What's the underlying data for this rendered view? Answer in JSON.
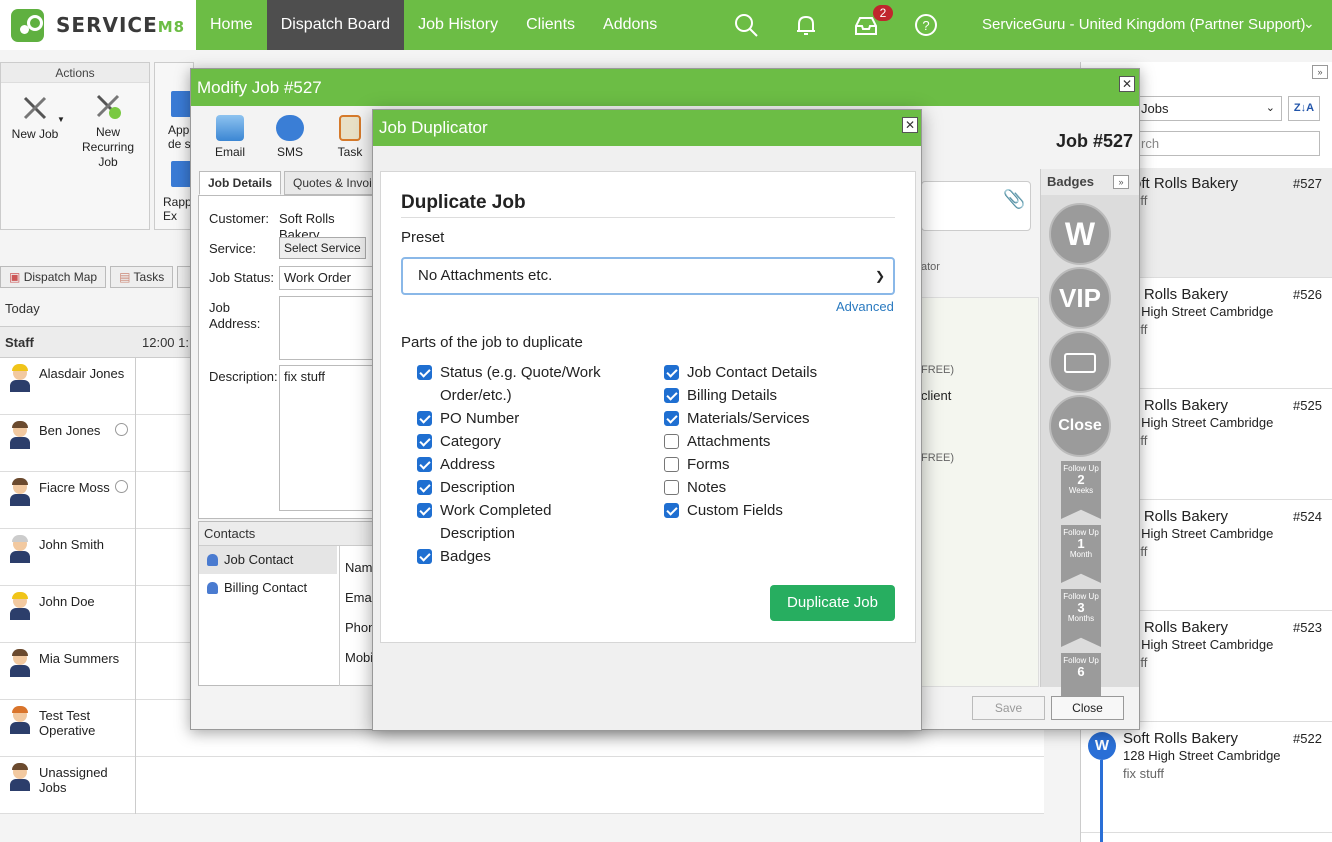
{
  "topbar": {
    "brand_main": "SERVICE",
    "brand_suffix": "M8",
    "nav": [
      "Home",
      "Dispatch Board",
      "Job History",
      "Clients",
      "Addons"
    ],
    "notification_count": "2",
    "account": "ServiceGuru - United Kingdom (Partner Support)"
  },
  "actions": {
    "title": "Actions",
    "new_job": "New Job",
    "new_recurring": "New Recurring Job",
    "partial_1": "App de s",
    "partial_2": "Rapp Ex"
  },
  "board": {
    "tabs": [
      "Dispatch Map",
      "Tasks"
    ],
    "today": "Today",
    "staff_header": "Staff",
    "time_header": "12:00  1:",
    "staff": [
      {
        "name": "Alasdair Jones",
        "hat": "#f0c419",
        "clock": false
      },
      {
        "name": "Ben Jones",
        "hat": "#6b4a2e",
        "clock": true
      },
      {
        "name": "Fiacre Moss",
        "hat": "#6b4a2e",
        "clock": true
      },
      {
        "name": "John Smith",
        "hat": "#cccccc",
        "clock": false
      },
      {
        "name": "John Doe",
        "hat": "#f0c419",
        "clock": false
      },
      {
        "name": "Mia Summers",
        "hat": "#6b4a2e",
        "clock": false
      },
      {
        "name": "Test Test Operative",
        "hat": "#d9742b",
        "clock": false
      },
      {
        "name": "Unassigned Jobs",
        "hat": "#6b4a2e",
        "clock": false
      }
    ]
  },
  "job_list": {
    "filter": "Jobs",
    "sort": "Z↓A",
    "search_placeholder": "rch",
    "jobs": [
      {
        "client": "Soft Rolls Bakery",
        "num": "#527",
        "addr": "",
        "desc": "stuff"
      },
      {
        "client": "oft Rolls Bakery",
        "num": "#526",
        "addr": "28 High Street Cambridge",
        "desc": "stuff"
      },
      {
        "client": "oft Rolls Bakery",
        "num": "#525",
        "addr": "28 High Street Cambridge",
        "desc": "stuff"
      },
      {
        "client": "oft Rolls Bakery",
        "num": "#524",
        "addr": "28 High Street Cambridge",
        "desc": "stuff"
      },
      {
        "client": "oft Rolls Bakery",
        "num": "#523",
        "addr": "28 High Street Cambridge",
        "desc": "stuff"
      },
      {
        "client": "Soft Rolls Bakery",
        "num": "#522",
        "addr": "128 High Street Cambridge",
        "desc": "fix stuff"
      }
    ]
  },
  "modify": {
    "title": "Modify Job #527",
    "tools": [
      "Email",
      "SMS",
      "Task"
    ],
    "job_header": "Job #527",
    "tabs": [
      "Job Details",
      "Quotes & Invoic"
    ],
    "customer_label": "Customer:",
    "customer_value": "Soft Rolls Bakery",
    "service_label": "Service:",
    "service_button": "Select Service",
    "status_label": "Job Status:",
    "status_value": "Work Order",
    "address_label": "Job Address:",
    "description_label": "Description:",
    "description_value": "fix stuff",
    "contacts_title": "Contacts",
    "contacts": [
      "Job Contact",
      "Billing Contact"
    ],
    "contact_fields": [
      "Nam",
      "Email",
      "Phon",
      "Mobi"
    ],
    "peek_1": "ator",
    "peek_2": "FREE)",
    "peek_client": "client",
    "peek_3": "FREE)",
    "badges_title": "Badges",
    "badge_w": "W",
    "badge_vip": "VIP",
    "badge_close": "Close",
    "flags": [
      {
        "top": "Follow Up",
        "num": "2",
        "unit": "Weeks"
      },
      {
        "top": "Follow Up",
        "num": "1",
        "unit": "Month"
      },
      {
        "top": "Follow Up",
        "num": "3",
        "unit": "Months"
      },
      {
        "top": "Follow Up",
        "num": "6",
        "unit": ""
      }
    ],
    "save": "Save",
    "close": "Close"
  },
  "duplicator": {
    "title": "Job Duplicator",
    "heading": "Duplicate Job",
    "preset_label": "Preset",
    "preset_value": "No Attachments etc.",
    "advanced": "Advanced",
    "parts_label": "Parts of the job to duplicate",
    "left": [
      {
        "label": "Status (e.g. Quote/Work",
        "label2": "Order/etc.)",
        "checked": true
      },
      {
        "label": "PO Number",
        "checked": true
      },
      {
        "label": "Category",
        "checked": true
      },
      {
        "label": "Address",
        "checked": true
      },
      {
        "label": "Description",
        "checked": true
      },
      {
        "label": "Work Completed",
        "label2": "Description",
        "checked": true
      },
      {
        "label": "Badges",
        "checked": true
      }
    ],
    "right": [
      {
        "label": "Job Contact Details",
        "checked": true
      },
      {
        "label": "Billing Details",
        "checked": true
      },
      {
        "label": "Materials/Services",
        "checked": true
      },
      {
        "label": "Attachments",
        "checked": false
      },
      {
        "label": "Forms",
        "checked": false
      },
      {
        "label": "Notes",
        "checked": false
      },
      {
        "label": "Custom Fields",
        "checked": true
      }
    ],
    "button": "Duplicate Job"
  }
}
